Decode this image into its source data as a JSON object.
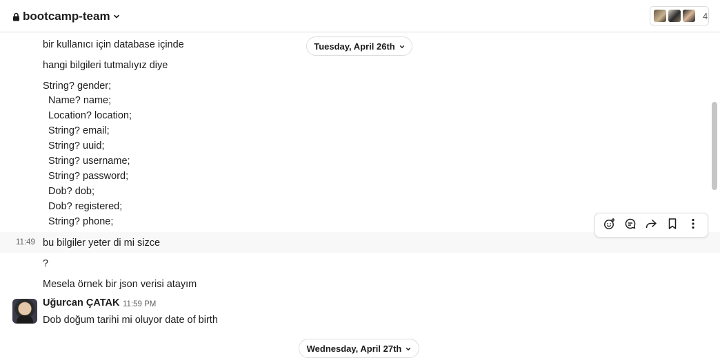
{
  "header": {
    "channel_name": "bootcamp-team",
    "member_count": "4"
  },
  "dates": {
    "first": "Tuesday, April 26th",
    "second": "Wednesday, April 27th"
  },
  "messages": {
    "lines": [
      "bir kullanıcı için database içinde",
      "hangi bilgileri tutmalıyız diye",
      "String? gender;",
      "  Name? name;",
      "  Location? location;",
      "  String? email;",
      "  String? uuid;",
      "  String? username;",
      "  String? password;",
      "  Dob? dob;",
      "  Dob? registered;",
      "  String? phone;"
    ],
    "hover_time": "11:49",
    "hover_text": "bu bilgiler yeter di mi sizce",
    "q_text": "?",
    "example_text": "Mesela örnek bir json verisi atayım",
    "author": {
      "name": "Uğurcan ÇATAK",
      "time": "11:59 PM",
      "text": "Dob doğum tarihi mi oluyor date of birth"
    }
  },
  "toolbar": {
    "icons": [
      "add-reaction-icon",
      "reply-thread-icon",
      "share-icon",
      "bookmark-icon",
      "more-icon"
    ]
  },
  "colors": {
    "text": "#1d1c1d",
    "muted": "#616061",
    "border": "#dddddd",
    "hover": "#f8f8f8"
  }
}
